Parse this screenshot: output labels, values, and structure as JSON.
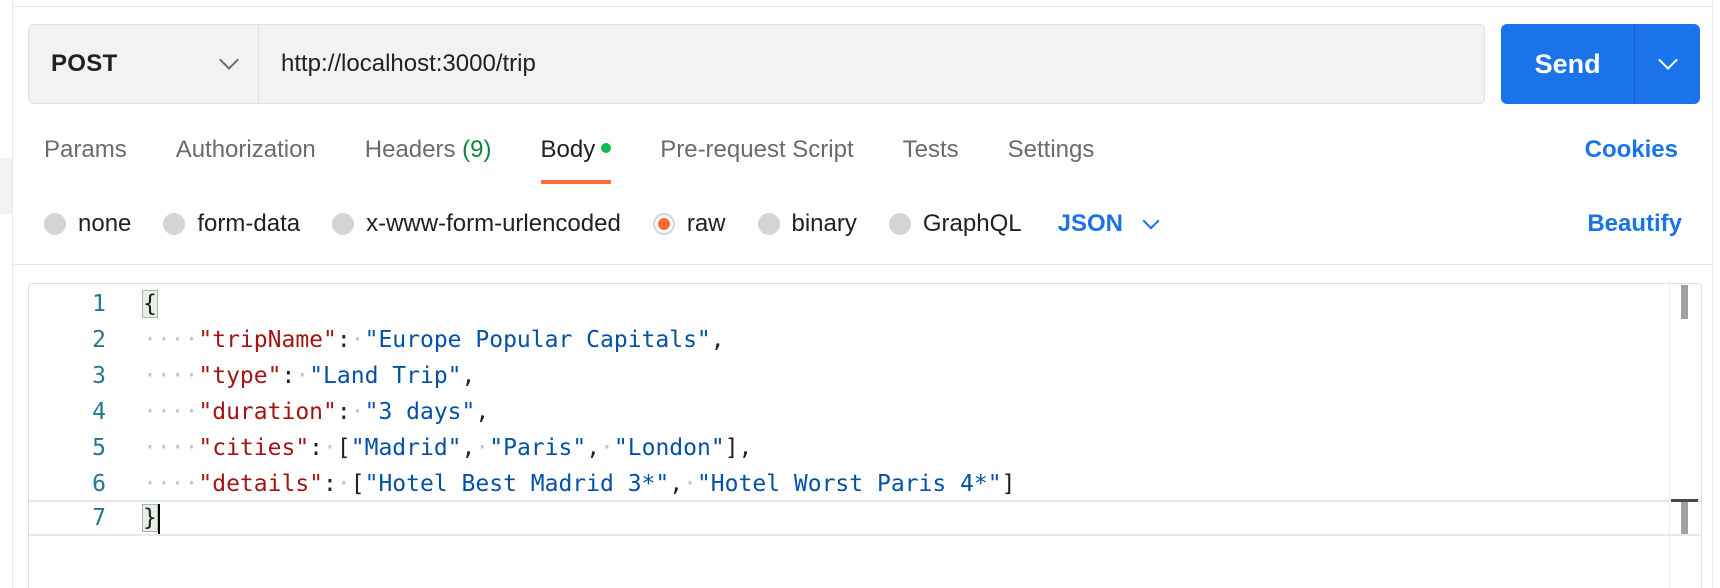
{
  "request": {
    "method": "POST",
    "url": "http://localhost:3000/trip",
    "send_label": "Send"
  },
  "tabs": [
    {
      "label": "Params"
    },
    {
      "label": "Authorization"
    },
    {
      "label": "Headers",
      "count": "(9)"
    },
    {
      "label": "Body",
      "active": true
    },
    {
      "label": "Pre-request Script"
    },
    {
      "label": "Tests"
    },
    {
      "label": "Settings"
    }
  ],
  "cookies_label": "Cookies",
  "body_types": [
    {
      "label": "none"
    },
    {
      "label": "form-data"
    },
    {
      "label": "x-www-form-urlencoded"
    },
    {
      "label": "raw",
      "selected": true
    },
    {
      "label": "binary"
    },
    {
      "label": "GraphQL"
    }
  ],
  "format": "JSON",
  "beautify_label": "Beautify",
  "editor": {
    "line_numbers": [
      "1",
      "2",
      "3",
      "4",
      "5",
      "6",
      "7"
    ],
    "lines": {
      "l1": {
        "brace": "{"
      },
      "l2": {
        "key": "\"tripName\"",
        "value": "\"Europe Popular Capitals\""
      },
      "l3": {
        "key": "\"type\"",
        "value": "\"Land Trip\""
      },
      "l4": {
        "key": "\"duration\"",
        "value": "\"3 days\""
      },
      "l5": {
        "key": "\"cities\"",
        "values": [
          "\"Madrid\"",
          "\"Paris\"",
          "\"London\""
        ]
      },
      "l6": {
        "key": "\"details\"",
        "values": [
          "\"Hotel Best Madrid 3*\"",
          "\"Hotel Worst Paris 4*\""
        ]
      },
      "l7": {
        "brace": "}"
      }
    }
  },
  "colors": {
    "accent_blue": "#1a73e8",
    "active_tab_underline": "#ff6c37",
    "body_dot": "#0cbb52",
    "header_count": "#0b8a3e",
    "json_key": "#a31515",
    "json_string": "#0451a5",
    "line_number": "#237893"
  },
  "icons": {
    "method_dropdown": "chevron-down-icon",
    "send_dropdown": "chevron-down-icon",
    "format_dropdown": "chevron-down-icon"
  }
}
